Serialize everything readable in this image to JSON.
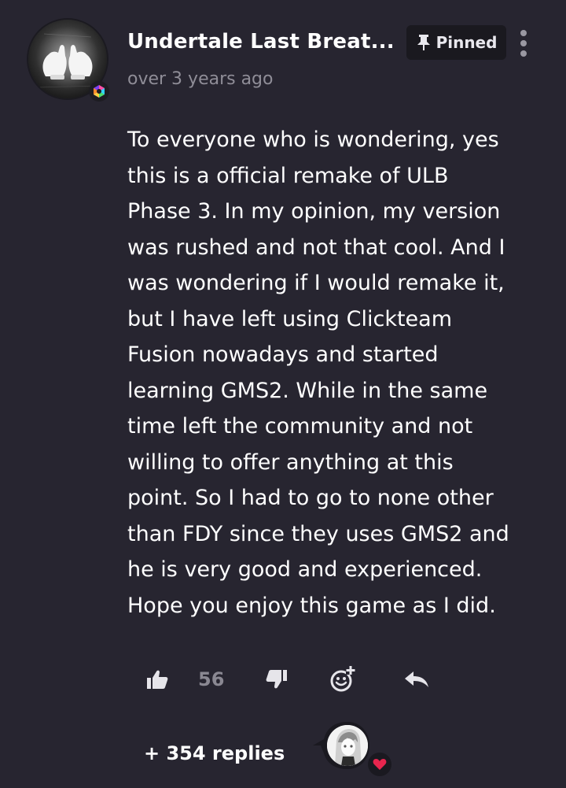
{
  "comment": {
    "username": "Undertale Last Breat...",
    "timestamp": "over 3 years ago",
    "pinned_label": "Pinned",
    "body_lines": [
      "To everyone who is wondering, yes",
      "this is a official remake of ULB",
      "Phase 3. In my opinion, my version",
      "was rushed and not that cool. And I",
      "was wondering if I would remake it,",
      "but I have left using Clickteam",
      "Fusion nowadays and started",
      "learning GMS2. While in the same",
      "time left the community and not",
      "willing to offer anything at this",
      "point. So I had to go to none other",
      "than FDY since they uses GMS2 and",
      "he is very good and experienced.",
      "Hope you enjoy this game as I did."
    ],
    "like_count": "56",
    "replies_label": "+ 354 replies"
  },
  "icons": {
    "avatar": "user-avatar",
    "badge": "creator-badge-icon",
    "pin": "pin-icon",
    "more": "more-vertical-icon",
    "like": "thumbs-up-icon",
    "dislike": "thumbs-down-icon",
    "emoji": "add-reaction-icon",
    "reply": "reply-icon",
    "reply_avatar": "replier-avatar",
    "heart": "heart-icon"
  },
  "colors": {
    "background": "#272530",
    "text": "#ffffff",
    "muted": "#8f8d97",
    "pinned_bg": "#1a191f",
    "heart": "#e8254e"
  }
}
